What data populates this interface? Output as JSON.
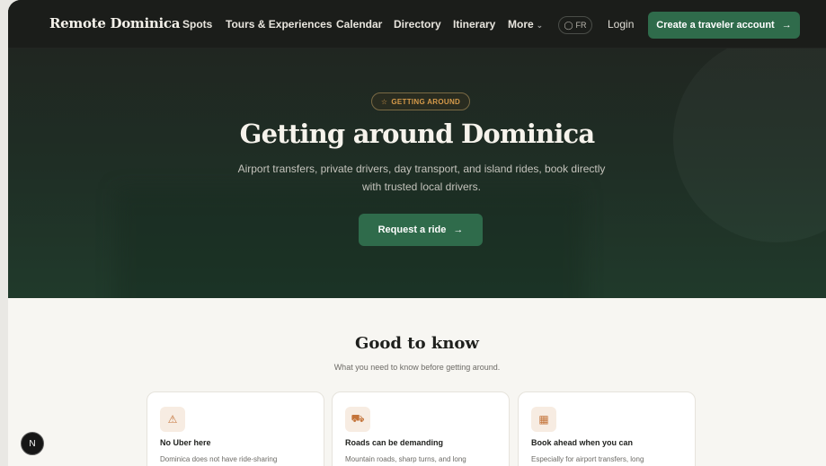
{
  "nav": {
    "brand": "Remote Dominica",
    "links": [
      "Spots",
      "Tours & Experiences",
      "Calendar",
      "Directory",
      "Itinerary"
    ],
    "more_label": "More",
    "lang_label": "FR",
    "login_label": "Login",
    "cta_label": "Create a traveler account"
  },
  "hero": {
    "pill_label": "GETTING AROUND",
    "title": "Getting around Dominica",
    "subtitle": "Airport transfers, private drivers, day transport, and island rides, book directly with trusted local drivers.",
    "cta_label": "Request a ride"
  },
  "good_to_know": {
    "title": "Good to know",
    "subtitle": "What you need to know before getting around.",
    "cards": [
      {
        "icon": "warning-icon",
        "title": "No Uber here",
        "text": "Dominica does not have ride-sharing"
      },
      {
        "icon": "car-icon",
        "title": "Roads can be demanding",
        "text": "Mountain roads, sharp turns, and long"
      },
      {
        "icon": "calendar-icon",
        "title": "Book ahead when you can",
        "text": "Especially for airport transfers, long"
      }
    ]
  },
  "dev_badge": "N",
  "colors": {
    "accent": "#2f6b4b",
    "hero_bg": "#1f2e25",
    "pill_text": "#d59a4a"
  }
}
